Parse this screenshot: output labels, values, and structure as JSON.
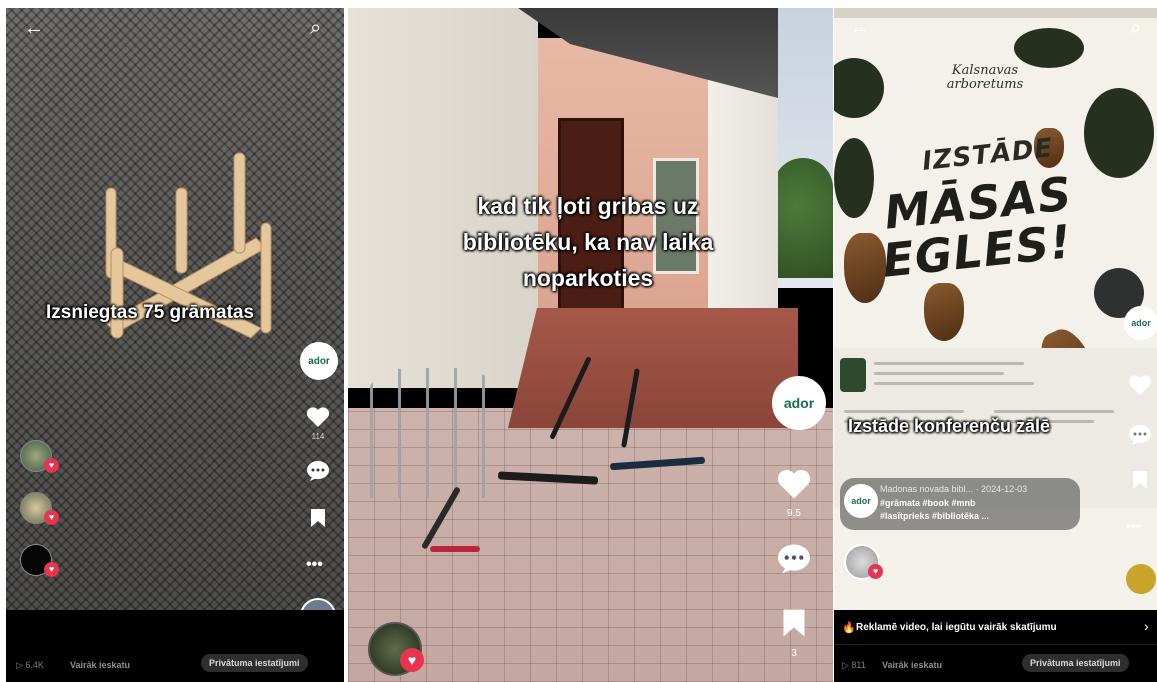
{
  "panels": [
    {
      "caption": "Izsniegtas 75 grāmatas",
      "icons": {
        "back": "arrow-left-icon",
        "search": "search-icon",
        "like": "heart-icon",
        "comment": "comment-icon",
        "save": "bookmark-icon",
        "share": "more-dots-icon"
      },
      "like_count": "114",
      "footer": {
        "views": "6.4K",
        "more": "Vairāk ieskatu",
        "privacy": "Privātuma iestatījumi"
      }
    },
    {
      "caption_lines": [
        "kad tik ļoti gribas uz",
        "bibliotēku, ka nav laika",
        "noparkoties"
      ],
      "like_count": "9.5",
      "save_count": "3",
      "icons": {
        "like": "heart-icon",
        "comment": "comment-icon",
        "save": "bookmark-icon"
      }
    },
    {
      "poster": {
        "sub_line1": "Kalsnavas",
        "sub_line2": "arboretums",
        "izstade": "IZSTĀDE",
        "line1": "MĀSAS",
        "line2": "EGLES!"
      },
      "caption": "Izstāde konferenču zālē",
      "author_line": "Madonas novada bibl... · 2024-12-03",
      "hashtags_line1": "#grāmata #book #mnb",
      "hashtags_line2": "#lasītprieks #bibliotēka ...",
      "promote": "Reklamē video, lai iegūtu vairāk skatījumu",
      "footer": {
        "views": "811",
        "more": "Vairāk ieskatu",
        "privacy": "Privātuma iestatījumi"
      },
      "icons": {
        "back": "arrow-left-icon",
        "search": "search-icon",
        "like": "heart-icon",
        "comment": "comment-icon",
        "save": "bookmark-icon",
        "promote": "flame-icon",
        "chevron": "chevron-right-icon"
      }
    }
  ],
  "brand_colors": {
    "heart_badge": "#e8344e",
    "library_green": "#1c6b54",
    "bar_bg": "#000000"
  }
}
